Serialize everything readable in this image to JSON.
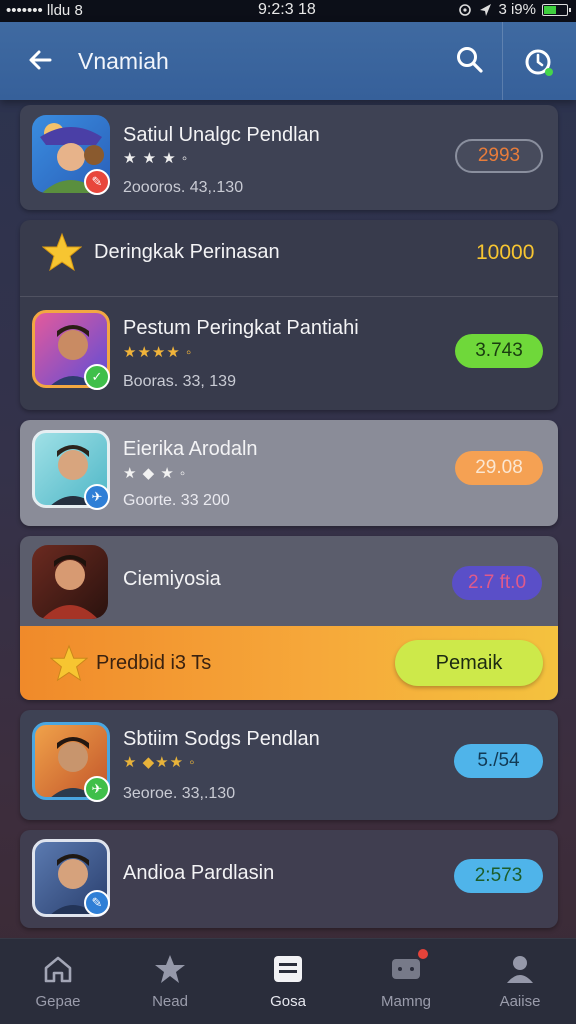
{
  "status_bar": {
    "carrier": "••••••• lldu 8",
    "time": "9:2:3 18",
    "battery": "3 i9%"
  },
  "header": {
    "title": "Vnamiah"
  },
  "items": [
    {
      "name": "Satiul Unalgc Pendlan",
      "stars": "★ ★ ★ ◦",
      "sub": "2oooros. 43,.130",
      "value": "2993"
    },
    {
      "name": "Pestum Peringkat Pantiahi",
      "stars": "★★★★ ◦",
      "sub": "Booras. 33, 139",
      "value": "3.743"
    },
    {
      "name": "Eierika Arodaln",
      "stars": "★ ◆ ★ ◦",
      "sub": "Goorte. 33 200",
      "value": "29.08"
    },
    {
      "name": "Ciemiyosia",
      "value": "2.7 ft.0"
    },
    {
      "name": "Sbtiim Sodgs Pendlan",
      "stars": "★ ◆★★ ◦",
      "sub": "3eoroe. 33,.130",
      "value": "5./54"
    },
    {
      "name": "Andioa Pardlasin",
      "value": "2:573"
    }
  ],
  "ranking_header": {
    "label": "Deringkak Perinasan",
    "value": "10000"
  },
  "promo": {
    "label": "Predbid i3 Ts",
    "button": "Pemaik"
  },
  "nav": [
    {
      "label": "Gepae",
      "icon": "home-icon"
    },
    {
      "label": "Nead",
      "icon": "star-icon"
    },
    {
      "label": "Gosa",
      "icon": "menu-icon"
    },
    {
      "label": "Mamng",
      "icon": "chat-icon"
    },
    {
      "label": "Aaiise",
      "icon": "profile-icon"
    }
  ],
  "colors": {
    "header": "#3f6aa1",
    "gold": "#f7c531",
    "pill_green": "#6fd83a",
    "pill_orange": "#f5a153",
    "pill_blue": "#4fb4ea",
    "promo_button": "#cde94a"
  }
}
